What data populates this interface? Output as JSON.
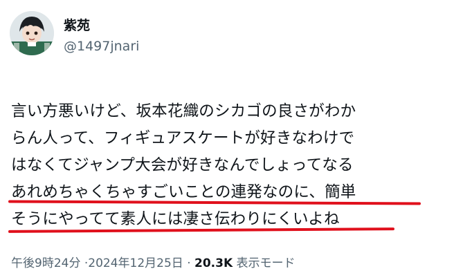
{
  "author": {
    "display_name": "紫苑",
    "handle": "@1497jnari"
  },
  "tweet": {
    "lines": [
      "言い方悪いけど、坂本花織のシカゴの良さがわか",
      "らん人って、フィギュアスケートが好きなわけで",
      "はなくてジャンプ大会が好きなんでしょってなる",
      "あれめちゃくちゃすごいことの連発なのに、簡単",
      "そうにやってて素人には凄さ伝わりにくいよね"
    ]
  },
  "meta": {
    "time": "午後9時24分",
    "separator1": " ·",
    "date": "2024年12月25日",
    "separator2": " · ",
    "views": "20.3K",
    "views_label": " 表示モード"
  },
  "colors": {
    "text": "#0f1419",
    "secondary": "#536471",
    "underline": "#e0101c"
  }
}
